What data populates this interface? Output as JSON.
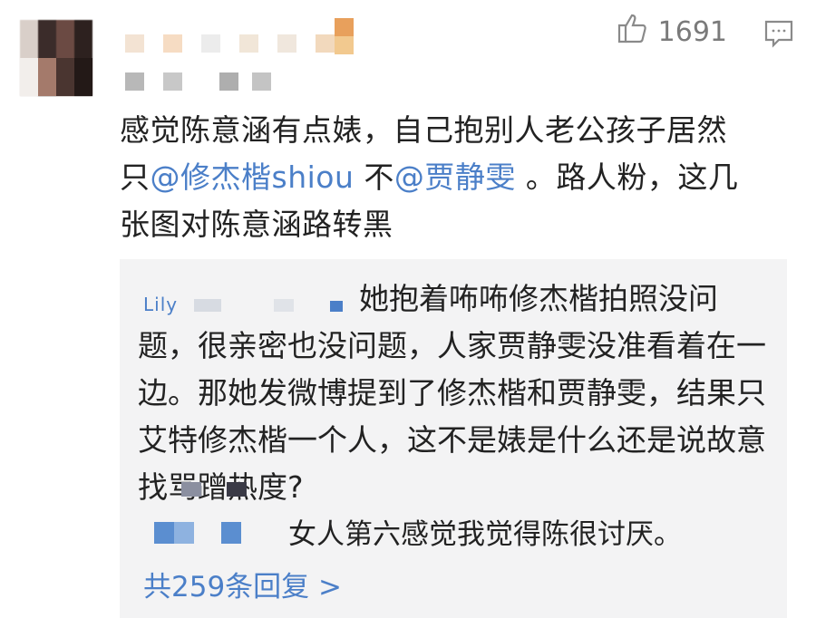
{
  "comment": {
    "likes": "1691",
    "text_part1": "感觉陈意涵有点婊，自己抱别人老公孩子居然只",
    "mention1": "@修杰楷shiou",
    "text_part2": " 不",
    "mention2": "@贾静雯",
    "text_part3": " 。路人粉，这几张图对陈意涵路转黑"
  },
  "replies": {
    "first_author_partial": "Lily",
    "first_text": "她抱着咘咘修杰楷拍照没问题，很亲密也没问题，人家贾静雯没准看着在一边。那她发微博提到了修杰楷和贾静雯，结果只艾特修杰楷一个人，这不是婊是什么还是说故意找骂蹭热度?",
    "second_text": "女人第六感觉我觉得陈很讨厌。",
    "more_link": "共259条回复 >"
  },
  "colors": {
    "link": "#4b7fc8",
    "reply_bg": "#f3f3f4",
    "text": "#222222",
    "muted": "#7a7a7a"
  },
  "icons": [
    "thumbs-up-icon",
    "comment-icon"
  ]
}
